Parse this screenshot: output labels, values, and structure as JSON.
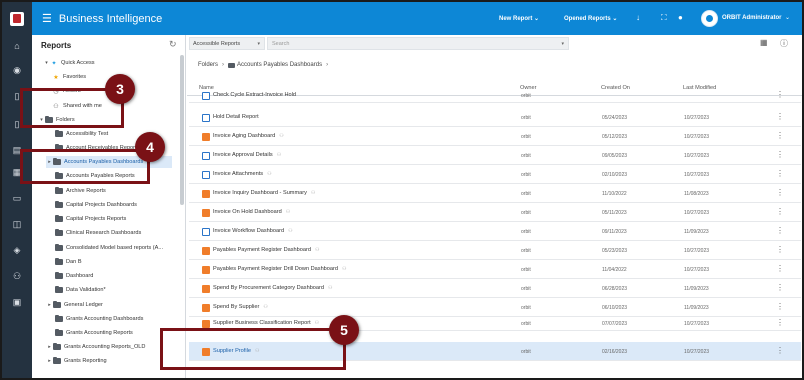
{
  "header": {
    "app_title": "Business Intelligence",
    "new_report": "New Report",
    "opened_reports": "Opened Reports",
    "user_name": "ORBIT Administrator",
    "brand_color": "#0d87d6"
  },
  "rail": {
    "icons": [
      "home-icon",
      "compass-icon",
      "doc-icon",
      "doc-icon",
      "database-icon",
      "chart-icon",
      "monitor-icon",
      "analytics-icon",
      "layers-icon",
      "users-icon",
      "report-icon"
    ]
  },
  "reports_panel": {
    "title": "Reports",
    "tree": [
      {
        "label": "Quick Access"
      },
      {
        "label": "Favorites"
      },
      {
        "label": "Recent"
      },
      {
        "label": "Shared with me"
      },
      {
        "label": "Folders"
      },
      {
        "label": "Accessibility Test"
      },
      {
        "label": "Account Receivables Reports"
      },
      {
        "label": "Accounts Payables Dashboards"
      },
      {
        "label": "Accounts Payables Reports"
      },
      {
        "label": "Archive Reports"
      },
      {
        "label": "Capital Projects Dashboards"
      },
      {
        "label": "Capital Projects Reports"
      },
      {
        "label": "Clinical Research Dashboards"
      },
      {
        "label": "Consolidated Model based reports (A..."
      },
      {
        "label": "Dan B"
      },
      {
        "label": "Dashboard"
      },
      {
        "label": "Data Validation*"
      },
      {
        "label": "General Ledger"
      },
      {
        "label": "Grants Accounting Dashboards"
      },
      {
        "label": "Grants Accounting Reports"
      },
      {
        "label": "Grants Accounting Reports_OLD"
      },
      {
        "label": "Grants Reporting"
      }
    ]
  },
  "filter": {
    "select_value": "Accessible Reports",
    "search_placeholder": "Search"
  },
  "breadcrumb": {
    "root": "Folders",
    "current": "Accounts Payables Dashboards"
  },
  "table": {
    "headers": {
      "name": "Name",
      "owner": "Owner",
      "created": "Created On",
      "modified": "Last Modified"
    },
    "rows": [
      {
        "name": "Check Cycle Extract-Invoice Hold",
        "owner": "orbit",
        "created": "",
        "modified": ""
      },
      {
        "name": "Hold Detail Report",
        "owner": "orbit",
        "created": "05/24/2023",
        "modified": "10/27/2023"
      },
      {
        "name": "Invoice Aging Dashboard",
        "owner": "orbit",
        "created": "05/12/2023",
        "modified": "10/27/2023"
      },
      {
        "name": "Invoice Approval Details",
        "owner": "orbit",
        "created": "09/05/2023",
        "modified": "10/27/2023"
      },
      {
        "name": "Invoice Attachments",
        "owner": "orbit",
        "created": "02/10/2023",
        "modified": "10/27/2023"
      },
      {
        "name": "Invoice Inquiry Dashboard - Summary",
        "owner": "orbit",
        "created": "11/10/2022",
        "modified": "11/08/2023"
      },
      {
        "name": "Invoice On Hold Dashboard",
        "owner": "orbit",
        "created": "05/11/2023",
        "modified": "10/27/2023"
      },
      {
        "name": "Invoice Workflow Dashboard",
        "owner": "orbit",
        "created": "09/11/2023",
        "modified": "11/09/2023"
      },
      {
        "name": "Payables Payment Register Dashboard",
        "owner": "orbit",
        "created": "05/23/2023",
        "modified": "10/27/2023"
      },
      {
        "name": "Payables Payment Register Drill Down Dashboard",
        "owner": "orbit",
        "created": "11/04/2022",
        "modified": "10/27/2023"
      },
      {
        "name": "Spend By Procurement Category Dashboard",
        "owner": "orbit",
        "created": "06/28/2023",
        "modified": "11/09/2023"
      },
      {
        "name": "Spend By Supplier",
        "owner": "orbit",
        "created": "06/10/2023",
        "modified": "11/09/2023"
      },
      {
        "name": "Supplier Business Classification Report",
        "owner": "orbit",
        "created": "07/07/2023",
        "modified": "10/27/2023"
      },
      {
        "name": "Supplier Profile",
        "owner": "orbit",
        "created": "02/16/2023",
        "modified": "10/27/2023"
      }
    ]
  },
  "callouts": {
    "c3": "3",
    "c4": "4",
    "c5": "5",
    "color": "#7a1116"
  }
}
